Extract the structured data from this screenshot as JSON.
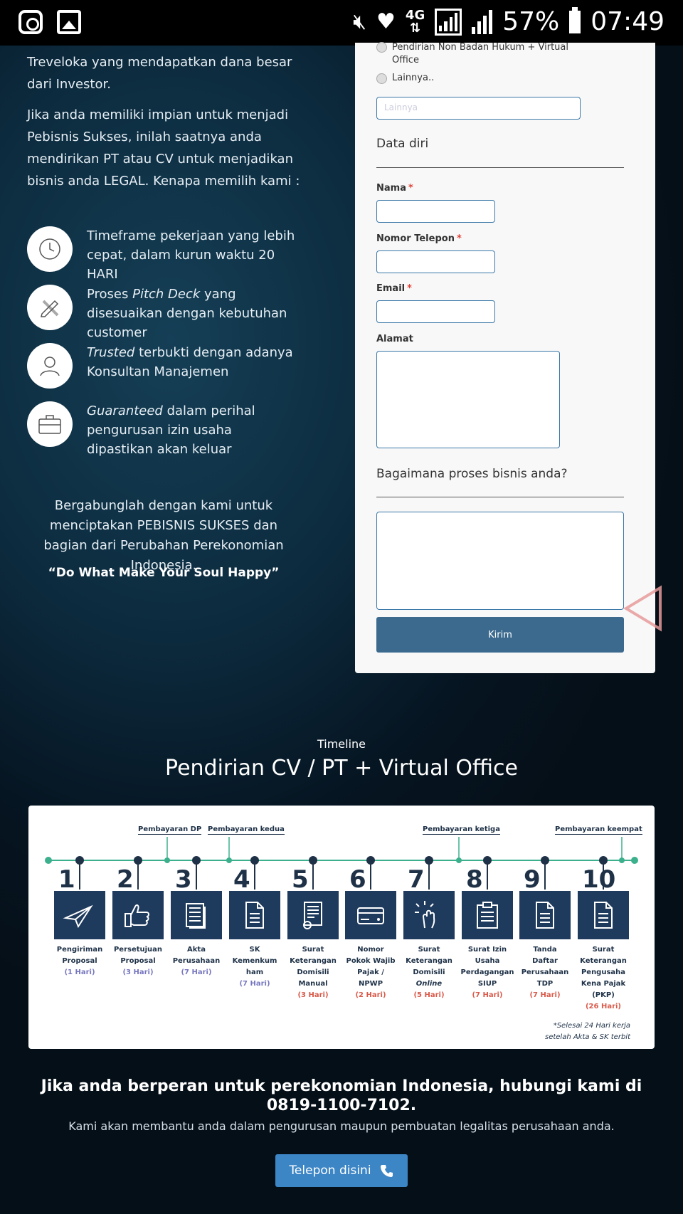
{
  "status_bar": {
    "icons": [
      "instagram-icon",
      "image-icon",
      "mute-icon",
      "heart-icon",
      "4g-icon",
      "signal-icon",
      "signal-icon",
      "battery-icon"
    ],
    "network": "4G",
    "battery": "57%",
    "time": "07:49"
  },
  "left": {
    "intro": "Treveloka yang mendapatkan dana besar dari Investor.",
    "paragraph": "Jika anda memiliki impian untuk menjadi Pebisnis Sukses, inilah saatnya anda mendirikan PT atau CV untuk menjadikan bisnis anda LEGAL. Kenapa memilih kami :",
    "features": [
      {
        "icon": "clock-icon",
        "pre": "",
        "em": "",
        "text": "Timeframe pekerjaan yang lebih cepat, dalam kurun waktu 20 HARI"
      },
      {
        "icon": "pencil-ruler-icon",
        "pre": "Proses ",
        "em": "Pitch Deck",
        "text": " yang disesuaikan dengan kebutuhan customer"
      },
      {
        "icon": "user-icon",
        "pre": "",
        "em": "Trusted",
        "text": " terbukti dengan adanya Konsultan Manajemen"
      },
      {
        "icon": "briefcase-icon",
        "pre": "",
        "em": "Guaranteed",
        "text": " dalam perihal pengurusan izin usaha dipastikan akan keluar"
      }
    ],
    "join_text": "Bergabunglah dengan kami untuk menciptakan PEBISNIS SUKSES dan bagian dari Perubahan Perekonomian Indonesia.",
    "motto": "“Do What Make Your Soul Happy”"
  },
  "form": {
    "radio_partial": "Pendirian Non Badan Hukum + Virtual Office",
    "radio_other": "Lainnya..",
    "other_placeholder": "Lainnya",
    "section_personal": "Data diri",
    "name_label": "Nama",
    "phone_label": "Nomor Telepon",
    "email_label": "Email",
    "address_label": "Alamat",
    "required_mark": "*",
    "section_business": "Bagaimana proses bisnis anda?",
    "submit_label": "Kirim"
  },
  "timeline": {
    "small_title": "Timeline",
    "title": "Pendirian CV / PT + Virtual Office",
    "payments": [
      "Pembayaran DP",
      "Pembayaran kedua",
      "Pembayaran ketiga",
      "Pembayaran keempat"
    ],
    "steps": [
      {
        "num": "1",
        "icon": "paper-plane-icon",
        "lines": [
          "Pengiriman",
          "Proposal"
        ],
        "days": "(1 Hari)",
        "red": false
      },
      {
        "num": "2",
        "icon": "thumbs-up-icon",
        "lines": [
          "Persetujuan",
          "Proposal"
        ],
        "days": "(3 Hari)",
        "red": false
      },
      {
        "num": "3",
        "icon": "documents-icon",
        "lines": [
          "Akta",
          "Perusahaan"
        ],
        "days": "(7 Hari)",
        "red": false
      },
      {
        "num": "4",
        "icon": "document-icon",
        "lines": [
          "SK",
          "Kemenkum",
          "ham"
        ],
        "days": "(7 Hari)",
        "red": false
      },
      {
        "num": "5",
        "icon": "certificate-icon",
        "lines": [
          "Surat",
          "Keterangan",
          "Domisili",
          "Manual"
        ],
        "days": "(3 Hari)",
        "red": true
      },
      {
        "num": "6",
        "icon": "card-icon",
        "lines": [
          "Nomor",
          "Pokok Wajib",
          "Pajak /",
          "NPWP"
        ],
        "days": "(2 Hari)",
        "red": true
      },
      {
        "num": "7",
        "icon": "touch-icon",
        "lines": [
          "Surat",
          "Keterangan",
          "Domisili",
          "Online"
        ],
        "days": "(5 Hari)",
        "red": true
      },
      {
        "num": "8",
        "icon": "clipboard-icon",
        "lines": [
          "Surat Izin",
          "Usaha",
          "Perdagangan",
          "SIUP"
        ],
        "days": "(7 Hari)",
        "red": true
      },
      {
        "num": "9",
        "icon": "document-icon",
        "lines": [
          "Tanda",
          "Daftar",
          "Perusahaan",
          "TDP"
        ],
        "days": "(7 Hari)",
        "red": true
      },
      {
        "num": "10",
        "icon": "document-icon",
        "lines": [
          "Surat",
          "Keterangan",
          "Pengusaha",
          "Kena Pajak",
          "(PKP)"
        ],
        "days": "(26 Hari)",
        "red": true
      }
    ],
    "note_line1": "*Selesai 24 Hari kerja",
    "note_line2": "setelah Akta & SK terbit"
  },
  "cta": {
    "title": "Jika anda berperan untuk perekonomian Indonesia, hubungi kami di 0819-1100-7102.",
    "subtitle": "Kami akan membantu anda dalam pengurusan maupun pembuatan legalitas perusahaan anda.",
    "button_label": "Telepon disini",
    "button_icon": "phone-icon"
  },
  "colors": {
    "background": "#0c2a3d",
    "card": "#f8f8f8",
    "input_border": "#3b78a8",
    "submit": "#3b6a8e",
    "timeline_dark": "#1e3a5c",
    "timeline_green": "#3cb08c",
    "cta_button": "#3d86c6",
    "required": "#e0443a"
  }
}
